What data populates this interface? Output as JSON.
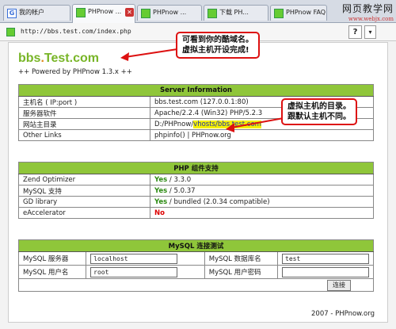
{
  "tabs": [
    {
      "label": "我的帐户",
      "icon": "google-g-icon"
    },
    {
      "label": "PHPnow ...",
      "icon": "php-page-icon",
      "active": true
    },
    {
      "label": "PHPnow ...",
      "icon": "php-page-icon"
    },
    {
      "label": "下载 PH...",
      "icon": "php-page-icon"
    },
    {
      "label": "PHPnow FAQ",
      "icon": "php-page-icon"
    }
  ],
  "watermark": {
    "line1": "网页教学网",
    "line2": "www.webjx.com"
  },
  "address": {
    "url": "http://bbs.test.com/index.php",
    "help_label": "?",
    "dropdown_label": "▾"
  },
  "site": {
    "brand_part1": "bbs",
    "brand_dot": ".",
    "brand_part2": "Test.com",
    "powered": "++ Powered by PHPnow 1.3.x ++"
  },
  "server_info": {
    "title": "Server Information",
    "rows": [
      {
        "label": "主机名 ( IP:port )",
        "value": "bbs.test.com (127.0.0.1:80)"
      },
      {
        "label": "服务器软件",
        "value": "Apache/2.2.4 (Win32) PHP/5.2.3"
      },
      {
        "label": "网站主目录",
        "value_prefix": "D:/PHPnow/",
        "value_highlight": "vhosts/bbs.test.com"
      },
      {
        "label": "Other Links",
        "value": "phpinfo() | PHPnow.org"
      }
    ]
  },
  "php_support": {
    "title": "PHP 组件支持",
    "rows": [
      {
        "label": "Zend Optimizer",
        "status": "Yes",
        "detail": " / 3.3.0"
      },
      {
        "label": "MySQL 支持",
        "status": "Yes",
        "detail": " / 5.0.37"
      },
      {
        "label": "GD library",
        "status": "Yes",
        "detail": " / bundled (2.0.34 compatible)"
      },
      {
        "label": "eAccelerator",
        "status": "No",
        "detail": ""
      }
    ]
  },
  "mysql_test": {
    "title": "MySQL 连接测试",
    "server_label": "MySQL 服务器",
    "server_value": "localhost",
    "dbname_label": "MySQL 数据库名",
    "dbname_value": "test",
    "user_label": "MySQL 用户名",
    "user_value": "root",
    "password_label": "MySQL 用户密码",
    "password_value": "",
    "connect_label": "连接"
  },
  "footer": "2007 - PHPnow.org",
  "annotations": {
    "callout1_line1": "可看到你的酷域名。",
    "callout1_line2": "虚拟主机开设完成!",
    "callout2_line1": "虚拟主机的目录。",
    "callout2_line2": "跟默认主机不同。"
  },
  "colors": {
    "brand_green": "#78b527",
    "header_green": "#8fc63a",
    "yes_green": "#2c8a12",
    "no_red": "#d00",
    "callout_red": "#d11",
    "highlight_yellow": "#f5f000"
  }
}
